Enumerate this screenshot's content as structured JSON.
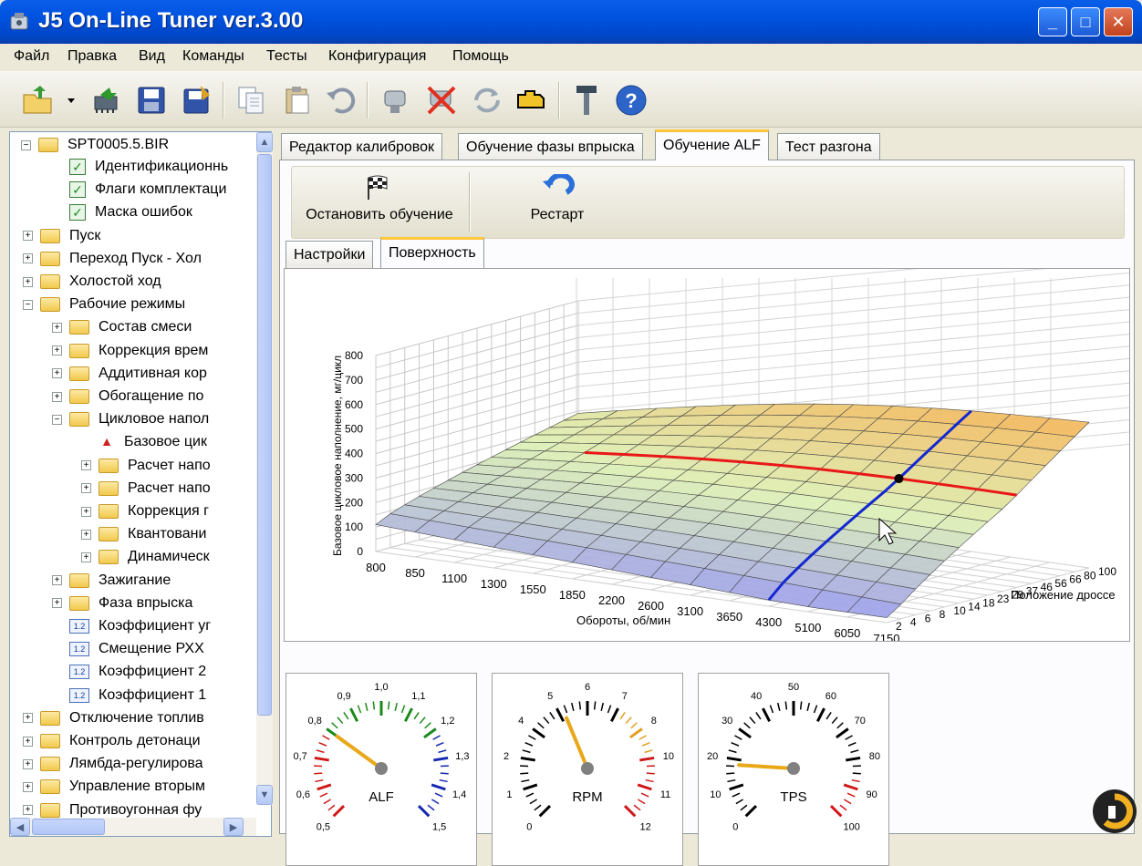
{
  "window": {
    "title": "J5 On-Line Tuner ver.3.00",
    "buttons": [
      "_",
      "□",
      "✕"
    ]
  },
  "menu": [
    "Файл",
    "Правка",
    "Вид",
    "Команды",
    "Тесты",
    "Конфигурация",
    "Помощь"
  ],
  "toolbar_icons": [
    "open-folder-icon",
    "dropdown-arrow-icon",
    "chip-write-icon",
    "save-icon",
    "save-as-icon",
    "copy-icon",
    "paste-icon",
    "undo-icon",
    "connect-icon",
    "disconnect-icon",
    "refresh-icon",
    "engine-icon",
    "tools-icon",
    "help-icon"
  ],
  "tree": {
    "root": "SPT0005.5.BIR",
    "items": [
      {
        "label": "Идентификационнь",
        "icon": "check",
        "indent": 1
      },
      {
        "label": "Флаги комплектаци",
        "icon": "check",
        "indent": 1
      },
      {
        "label": "Маска ошибок",
        "icon": "check",
        "indent": 1
      },
      {
        "label": "Пуск",
        "icon": "folder",
        "indent": 0,
        "pm": "+"
      },
      {
        "label": "Переход Пуск - Хол",
        "icon": "folder",
        "indent": 0,
        "pm": "+"
      },
      {
        "label": "Холостой ход",
        "icon": "folder",
        "indent": 0,
        "pm": "+"
      },
      {
        "label": "Рабочие режимы",
        "icon": "folder",
        "indent": 0,
        "pm": "−"
      },
      {
        "label": "Состав смеси",
        "icon": "folder",
        "indent": 1,
        "pm": "+"
      },
      {
        "label": "Коррекция врем",
        "icon": "folder",
        "indent": 1,
        "pm": "+"
      },
      {
        "label": "Аддитивная кор",
        "icon": "folder",
        "indent": 1,
        "pm": "+"
      },
      {
        "label": "Обогащение по",
        "icon": "folder",
        "indent": 1,
        "pm": "+"
      },
      {
        "label": "Цикловое напол",
        "icon": "folder",
        "indent": 1,
        "pm": "−"
      },
      {
        "label": "Базовое цик",
        "icon": "chart",
        "indent": 2
      },
      {
        "label": "Расчет напо",
        "icon": "folder",
        "indent": 2,
        "pm": "+"
      },
      {
        "label": "Расчет напо",
        "icon": "folder",
        "indent": 2,
        "pm": "+"
      },
      {
        "label": "Коррекция г",
        "icon": "folder",
        "indent": 2,
        "pm": "+"
      },
      {
        "label": "Квантовани",
        "icon": "folder",
        "indent": 2,
        "pm": "+"
      },
      {
        "label": "Динамическ",
        "icon": "folder",
        "indent": 2,
        "pm": "+"
      },
      {
        "label": "Зажигание",
        "icon": "folder",
        "indent": 1,
        "pm": "+"
      },
      {
        "label": "Фаза впрыска",
        "icon": "folder",
        "indent": 1,
        "pm": "+"
      },
      {
        "label": "Коэффициент уг",
        "icon": "num",
        "indent": 1
      },
      {
        "label": "Смещение РХХ",
        "icon": "num",
        "indent": 1
      },
      {
        "label": "Коэффициент 2",
        "icon": "num",
        "indent": 1
      },
      {
        "label": "Коэффициент 1",
        "icon": "num",
        "indent": 1
      },
      {
        "label": "Отключение топлив",
        "icon": "folder",
        "indent": 0,
        "pm": "+"
      },
      {
        "label": "Контроль детонаци",
        "icon": "folder",
        "indent": 0,
        "pm": "+"
      },
      {
        "label": "Лямбда-регулирова",
        "icon": "folder",
        "indent": 0,
        "pm": "+"
      },
      {
        "label": "Управление вторым",
        "icon": "folder",
        "indent": 0,
        "pm": "+"
      },
      {
        "label": "Противоугонная фу",
        "icon": "folder",
        "indent": 0,
        "pm": "+"
      }
    ],
    "num_badge": "1.2"
  },
  "tabs": [
    "Редактор калибровок",
    "Обучение фазы впрыска",
    "Обучение ALF",
    "Тест разгона"
  ],
  "commands": {
    "stop": "Остановить обучение",
    "restart": "Рестарт"
  },
  "subtabs": [
    "Настройки",
    "Поверхность"
  ],
  "chart_data": {
    "type": "surface3d",
    "zlabel": "Базовое цикловое наполнение, мг/цикл",
    "xlabel": "Обороты, об/мин",
    "ylabel": "Положение дроссе",
    "z_ticks": [
      "0",
      "100",
      "200",
      "300",
      "400",
      "500",
      "600",
      "700",
      "800"
    ],
    "x_ticks": [
      "800",
      "850",
      "1100",
      "1300",
      "1550",
      "1850",
      "2200",
      "2600",
      "3100",
      "3650",
      "4300",
      "5100",
      "6050",
      "7150"
    ],
    "y_ticks": [
      "2",
      "4",
      "6",
      "8",
      "10",
      "14",
      "18",
      "23",
      "29",
      "37",
      "46",
      "56",
      "66",
      "80",
      "100"
    ],
    "ylim": [
      0,
      800
    ],
    "grid": true,
    "colors": {
      "low": "#9090f0",
      "mid": "#d8f0b0",
      "high": "#f8b050",
      "rpm_line": "#e81818",
      "tps_line": "#1428d0"
    }
  },
  "gauges": [
    {
      "name": "ALF",
      "ticks": [
        "0,5",
        "0,6",
        "0,7",
        "0,8",
        "0,9",
        "1,0",
        "1,1",
        "1,2",
        "1,3",
        "1,4",
        "1,5"
      ],
      "min": 0.5,
      "max": 1.5,
      "value": 0.8
    },
    {
      "name": "RPM",
      "ticks": [
        "0",
        "1",
        "2",
        "4",
        "5",
        "6",
        "7",
        "8",
        "10",
        "11",
        "12"
      ],
      "min": 0,
      "max": 12,
      "value": 5
    },
    {
      "name": "TPS",
      "ticks": [
        "0",
        "10",
        "20",
        "30",
        "40",
        "50",
        "60",
        "70",
        "80",
        "90",
        "100"
      ],
      "min": 0,
      "max": 100,
      "value": 18
    }
  ]
}
